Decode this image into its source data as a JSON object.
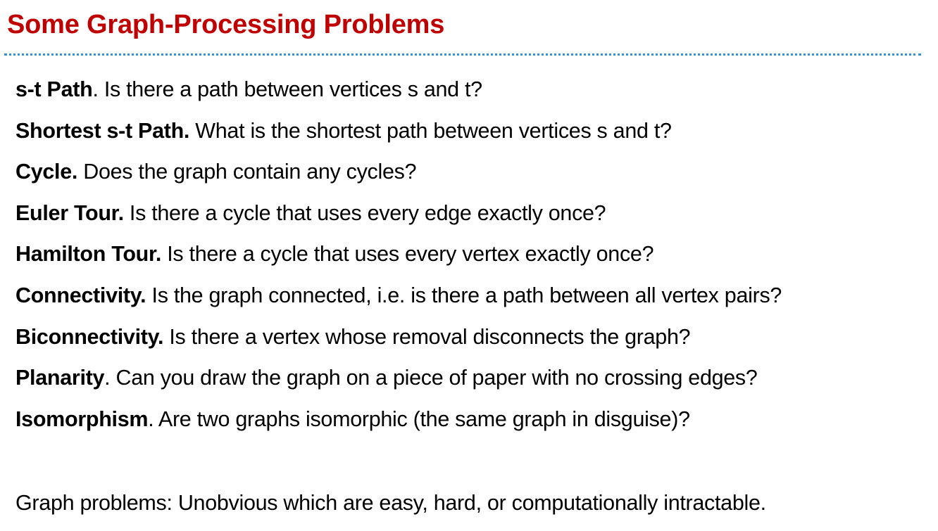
{
  "slide": {
    "title": "Some Graph-Processing Problems",
    "title_color": "#c00000",
    "rule_color": "#3a8fd0"
  },
  "problems": [
    {
      "term": "s-t Path",
      "sep": ".",
      "description": " Is there a path between vertices s and t?"
    },
    {
      "term": "Shortest s-t Path.",
      "sep": "",
      "description": " What is the shortest path between vertices s and t?"
    },
    {
      "term": "Cycle.",
      "sep": "",
      "description": " Does the graph contain any cycles?"
    },
    {
      "term": "Euler Tour.",
      "sep": "",
      "description": " Is there a cycle that uses every edge exactly once?"
    },
    {
      "term": "Hamilton Tour.",
      "sep": "",
      "description": " Is there a cycle that uses every vertex exactly once?"
    },
    {
      "term": "Connectivity.",
      "sep": "",
      "description": " Is the graph connected, i.e. is there a path between all vertex pairs?"
    },
    {
      "term": "Biconnectivity.",
      "sep": "",
      "description": " Is there a vertex whose removal disconnects the graph?"
    },
    {
      "term": "Planarity",
      "sep": ".",
      "description": " Can you draw the graph on a piece of paper with no crossing edges?"
    },
    {
      "term": "Isomorphism",
      "sep": ".",
      "description": " Are two graphs isomorphic (the same graph in disguise)?"
    }
  ],
  "summary": "Graph problems: Unobvious which are easy, hard, or computationally intractable."
}
